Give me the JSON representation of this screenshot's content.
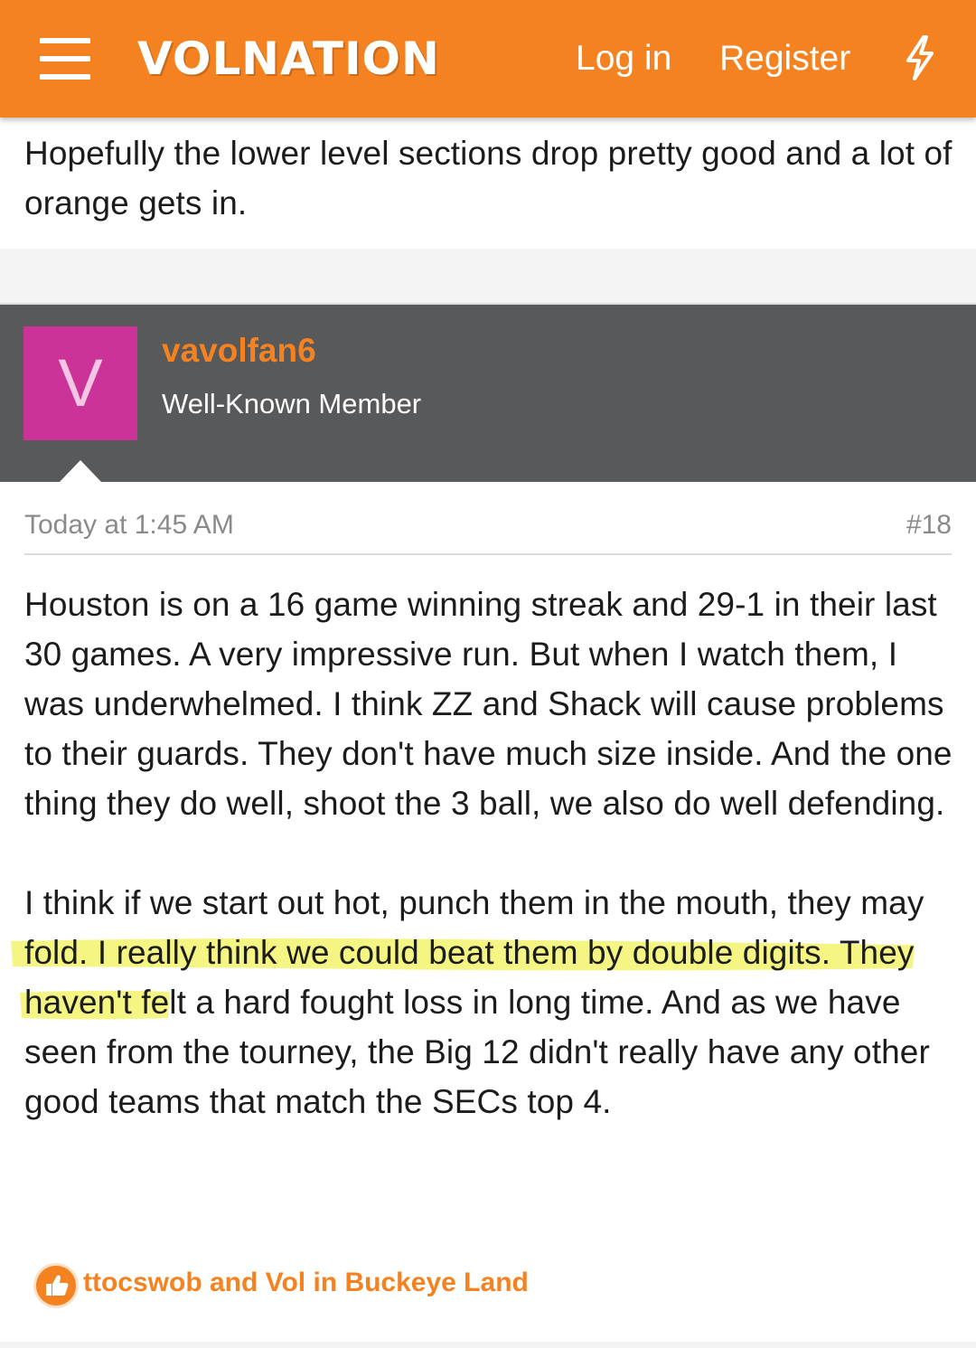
{
  "header": {
    "logo": "VOLNATION",
    "login": "Log in",
    "register": "Register",
    "icon": "lightning-bolt-icon"
  },
  "previous_post": {
    "text": "Hopefully the lower level sections drop pretty good and a lot of orange gets in."
  },
  "user": {
    "avatar_letter": "V",
    "avatar_color": "#cc3399",
    "name": "vavolfan6",
    "title": "Well-Known Member"
  },
  "post": {
    "date": "Today at 1:45 AM",
    "number": "#18",
    "para1": "Houston is on a 16 game winning streak and 29-1 in their last 30 games. A very impressive run. But when I watch them, I was underwhelmed. I think ZZ and Shack will cause problems to their guards. They don't have much size inside. And the one thing they do well, shoot the 3 ball, we also do well defending.",
    "para2": "I think if we start out hot, punch them in the mouth, they may fold. I really think we could beat them by double digits. They haven't felt a hard fought loss in long time. And as we have seen from the tourney, the Big 12 didn't really have any other good teams that match the SECs top 4."
  },
  "reactions": {
    "icon": "like-thumbs-up-icon",
    "text": "ttocswob and Vol in Buckeye Land"
  },
  "colors": {
    "brand_orange": "#f58220",
    "user_bar": "#58595b",
    "highlight": "#f2f25a"
  }
}
